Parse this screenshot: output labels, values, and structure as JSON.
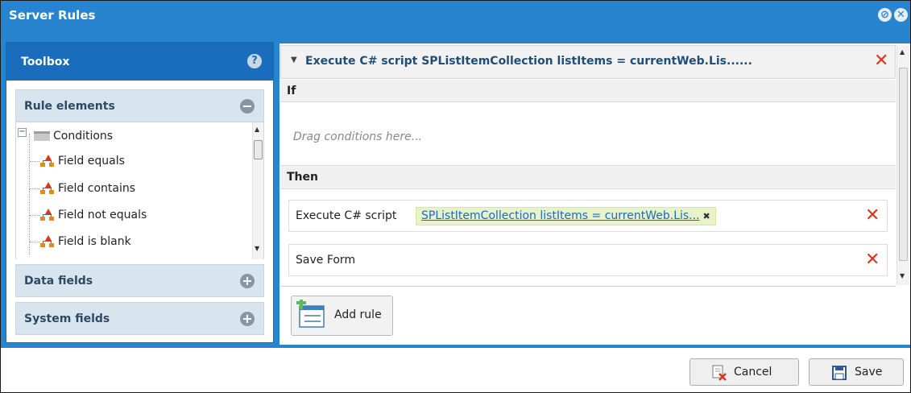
{
  "window": {
    "title": "Server Rules"
  },
  "toolbox": {
    "title": "Toolbox",
    "sections": {
      "rule_elements": "Rule elements",
      "data_fields": "Data fields",
      "system_fields": "System fields"
    },
    "tree": {
      "root": "Conditions",
      "items": [
        "Field equals",
        "Field contains",
        "Field not equals",
        "Field is blank"
      ]
    }
  },
  "rule": {
    "header_title": "Execute C# script SPListItemCollection listItems = currentWeb.Lis......",
    "if_label": "If",
    "drag_placeholder": "Drag conditions here...",
    "then_label": "Then",
    "actions": [
      {
        "label": "Execute C# script",
        "chip": "SPListItemCollection listItems = currentWeb.Lis..."
      },
      {
        "label": "Save Form"
      }
    ],
    "add_rule_label": "Add rule"
  },
  "footer": {
    "cancel_label": "Cancel",
    "save_label": "Save"
  },
  "colors": {
    "accent": "#2884cf",
    "toolbox_header": "#1a6cbc",
    "delete": "#d9361a",
    "chip_bg": "#e8f3cc",
    "link": "#1a69c2"
  }
}
